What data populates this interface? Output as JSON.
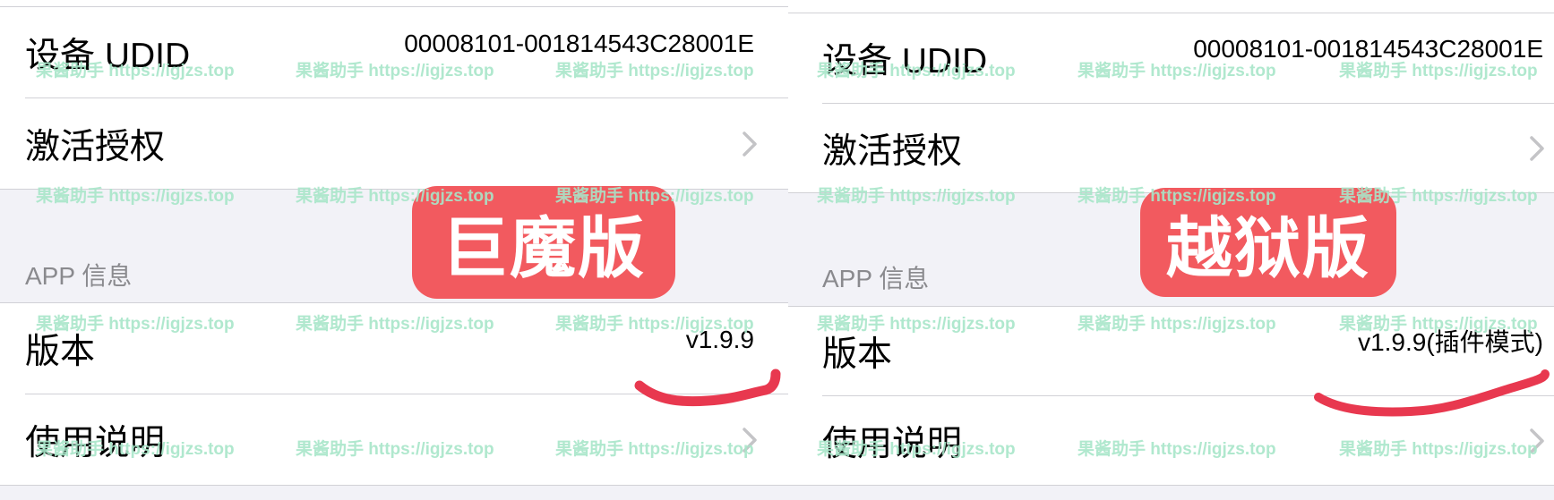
{
  "left_panel": {
    "device_udid": {
      "label": "设备 UDID",
      "value": "00008101-001814543C28001E"
    },
    "activate": {
      "label": "激活授权"
    },
    "section_header": "APP 信息",
    "version": {
      "label": "版本",
      "value": "v1.9.9"
    },
    "usage": {
      "label": "使用说明"
    },
    "badge": "巨魔版"
  },
  "right_panel": {
    "device_udid": {
      "label": "设备 UDID",
      "value": "00008101-001814543C28001E"
    },
    "activate": {
      "label": "激活授权"
    },
    "section_header": "APP 信息",
    "version": {
      "label": "版本",
      "value": "v1.9.9(插件模式)"
    },
    "usage": {
      "label": "使用说明"
    },
    "badge": "越狱版"
  },
  "watermark": "果酱助手  https://igjzs.top",
  "colors": {
    "badge": "#f25a5f",
    "scribble": "#e8384f",
    "watermark": "#a8e6c9",
    "section_bg": "#f2f2f7",
    "separator": "#d1d1d6",
    "secondary_text": "#8a8a8e"
  },
  "icons": {
    "chevron": "chevron-right-icon"
  }
}
